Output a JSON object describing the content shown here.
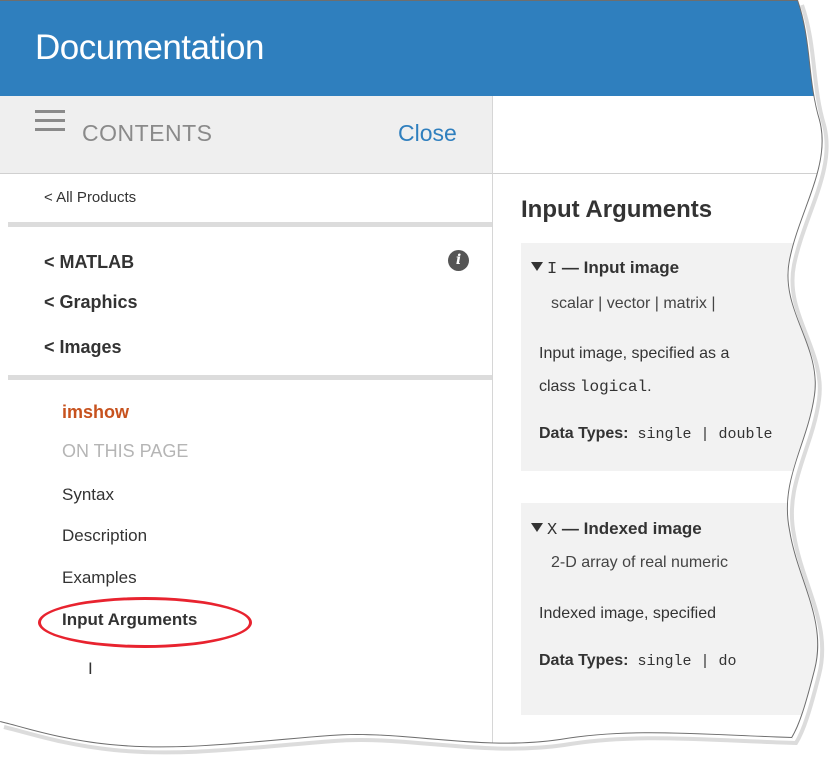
{
  "header": {
    "title": "Documentation"
  },
  "sidebar_head": {
    "contents_label": "CONTENTS",
    "close_label": "Close"
  },
  "sidebar": {
    "all_products": "< All Products",
    "breadcrumbs": [
      "< MATLAB",
      "< Graphics",
      "< Images"
    ],
    "info_icon": "i",
    "page_title": "imshow",
    "on_this_page": "ON THIS PAGE",
    "toc": [
      "Syntax",
      "Description",
      "Examples",
      "Input Arguments"
    ],
    "toc_sub": [
      "I"
    ]
  },
  "main": {
    "section_title": "Input Arguments",
    "args": [
      {
        "name_code": "I",
        "name_text": " — Input image",
        "type_line": "scalar | vector | matrix |",
        "desc_line1": "Input image, specified as a",
        "desc_line2_prefix": "class ",
        "desc_line2_code": "logical",
        "desc_line2_suffix": ".",
        "data_types_label": "Data Types:",
        "data_types": " single | double"
      },
      {
        "name_code": "X",
        "name_text": " — Indexed image",
        "type_line": "2-D array of real numeric",
        "desc_line1": "Indexed image, specified",
        "data_types_label": "Data Types:",
        "data_types": " single | do"
      }
    ]
  },
  "colors": {
    "header_bg": "#2f7fbe",
    "accent": "#2f7fbe",
    "page_title": "#c7521e",
    "highlight": "#e8232f"
  }
}
